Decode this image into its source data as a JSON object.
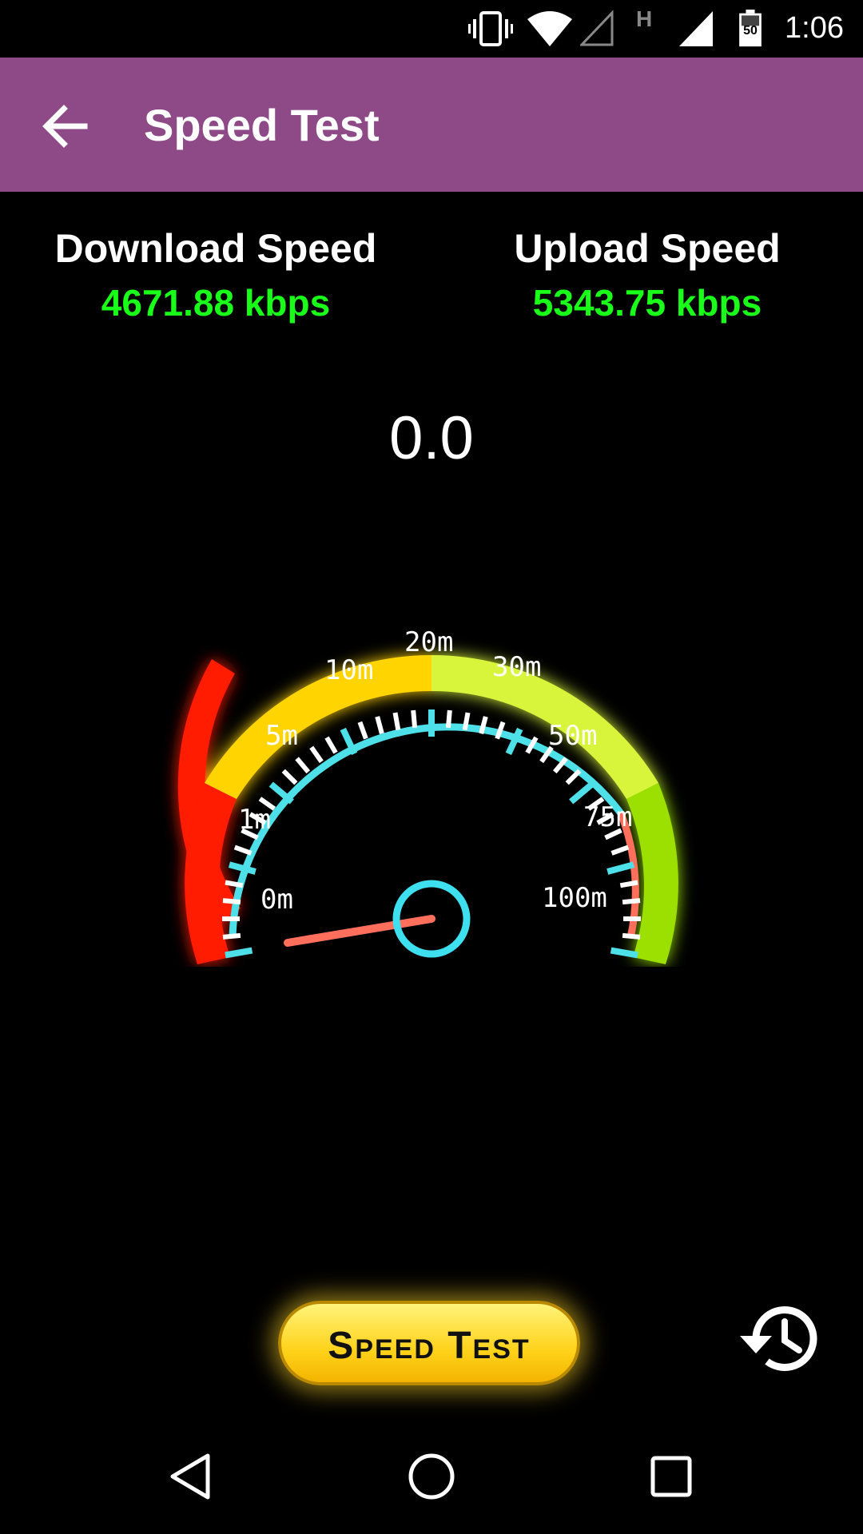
{
  "status_bar": {
    "time": "1:06",
    "battery_level": "50",
    "network_type": "H",
    "icons": [
      "vibrate-icon",
      "wifi-icon",
      "signal-empty-icon",
      "network-type-icon",
      "signal-icon",
      "battery-icon"
    ]
  },
  "app_bar": {
    "title": "Speed Test",
    "back_icon": "arrow-left-icon",
    "color": "#8e4a87"
  },
  "stats": {
    "download_label": "Download Speed",
    "download_value": "4671.88 kbps",
    "upload_label": "Upload Speed",
    "upload_value": "5343.75 kbps",
    "value_color": "#19ff19"
  },
  "gauge": {
    "current_value": "0.0",
    "labels": [
      "0m",
      "1m",
      "5m",
      "10m",
      "20m",
      "30m",
      "50m",
      "75m",
      "100m"
    ],
    "needle_level": 0.0,
    "colors": {
      "low": "#ff1a00",
      "mid": "#ffd400",
      "high": "#d8f53a",
      "max": "#9be000",
      "ticks": "#4ee0e8",
      "needle": "#ff6f5c"
    }
  },
  "actions": {
    "speed_test_label": "Speed Test",
    "history_icon": "history-icon"
  },
  "nav_bar": {
    "icons": [
      "back-triangle-icon",
      "home-circle-icon",
      "recents-square-icon"
    ]
  }
}
